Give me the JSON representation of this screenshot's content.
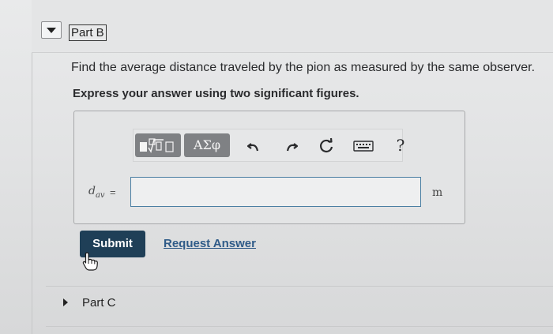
{
  "part_b": {
    "title": "Part B",
    "question": "Find the average distance traveled by the pion as measured by the same observer.",
    "instruction": "Express your answer using two significant figures."
  },
  "toolbar": {
    "templates_icon": "templates-icon",
    "greek_label": "ΑΣφ",
    "undo_icon": "undo-icon",
    "redo_icon": "redo-icon",
    "reset_icon": "reset-icon",
    "keyboard_icon": "keyboard-icon",
    "help_label": "?"
  },
  "answer": {
    "variable": "d",
    "variable_subscript": "av",
    "equals": "=",
    "value": "",
    "unit": "m"
  },
  "actions": {
    "submit_label": "Submit",
    "request_label": "Request Answer"
  },
  "part_c": {
    "title": "Part C"
  },
  "colors": {
    "submit_bg": "#1f3f57",
    "link": "#2f5b88",
    "input_border": "#4b7fa3"
  }
}
